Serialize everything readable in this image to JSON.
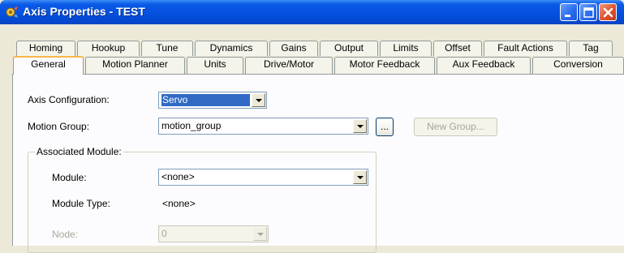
{
  "window": {
    "title": "Axis Properties - TEST",
    "icon": "axis-gear-icon",
    "controls": [
      "minimize-icon",
      "maximize-icon",
      "close-icon"
    ]
  },
  "tabs": {
    "row1": [
      "Homing",
      "Hookup",
      "Tune",
      "Dynamics",
      "Gains",
      "Output",
      "Limits",
      "Offset",
      "Fault Actions",
      "Tag"
    ],
    "row2": [
      "General",
      "Motion Planner",
      "Units",
      "Drive/Motor",
      "Motor Feedback",
      "Aux Feedback",
      "Conversion"
    ],
    "active": "General"
  },
  "general": {
    "axis_configuration": {
      "label": "Axis Configuration:",
      "value": "Servo"
    },
    "motion_group": {
      "label": "Motion Group:",
      "value": "motion_group",
      "browse_label": "...",
      "new_group_label": "New Group..."
    },
    "associated_module": {
      "legend": "Associated Module:",
      "module": {
        "label": "Module:",
        "value": "<none>"
      },
      "module_type": {
        "label": "Module Type:",
        "value": "<none>"
      },
      "node": {
        "label": "Node:",
        "value": "0"
      }
    }
  },
  "colors": {
    "titlebar": "#0551df",
    "dialog_bg": "#ece9d8",
    "panel_bg": "#fcfcfe",
    "selection": "#316ac5",
    "tab_highlight": "#f7b74a",
    "close_button": "#e0522e"
  }
}
